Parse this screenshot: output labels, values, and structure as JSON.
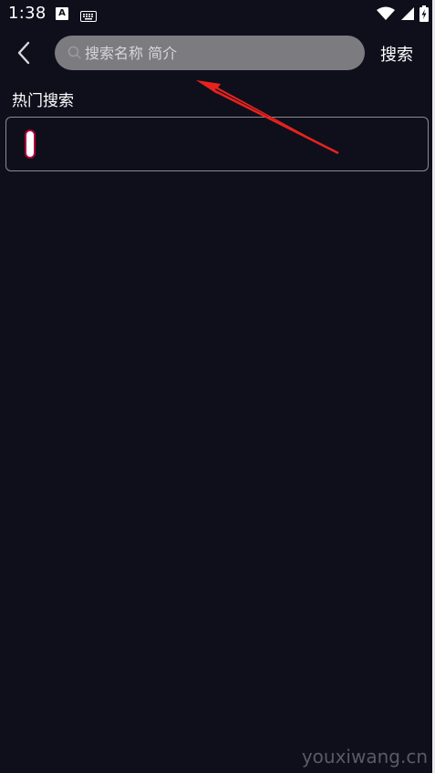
{
  "status_bar": {
    "time": "1:38",
    "notification_icon_letter": "A",
    "icons": [
      "text-a-icon",
      "keyboard-icon",
      "wifi-icon",
      "signal-icon",
      "battery-charging-icon"
    ]
  },
  "search": {
    "placeholder": "搜索名称 简介",
    "value": "",
    "button_label": "搜索"
  },
  "hot_search": {
    "title": "热门搜索",
    "items": []
  },
  "watermark": "youxiwang.cn",
  "colors": {
    "background": "#0f0f1c",
    "search_box": "#7b7b80",
    "annotation": "#e8231d",
    "cursor_border": "#b0003a"
  }
}
